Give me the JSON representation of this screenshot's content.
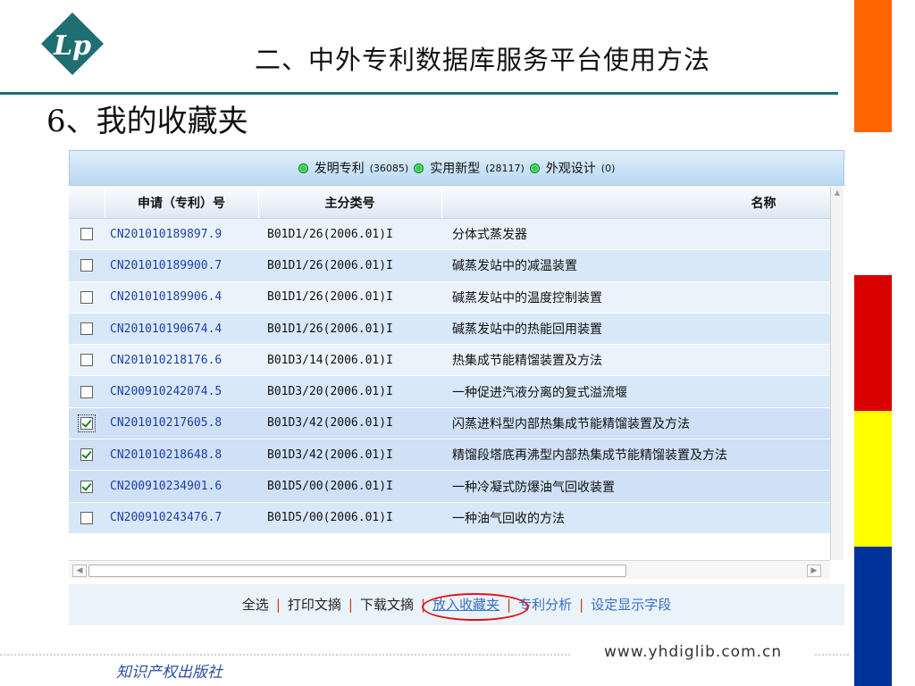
{
  "slide": {
    "title": "二、中外专利数据库服务平台使用方法",
    "subtitle": "6、我的收藏夹",
    "url": "www.yhdiglib.com.cn",
    "publisher": "知识产权出版社"
  },
  "colors": {
    "accent": "#1f6e72",
    "bar_orange": "#ff6600",
    "bar_red": "#d90000",
    "bar_yellow": "#ffff00",
    "bar_blue": "#003399",
    "link": "#3570c8",
    "annotation": "#e0141a"
  },
  "filters": [
    {
      "label": "发明专利",
      "count": "(36085)"
    },
    {
      "label": "实用新型",
      "count": "(28117)"
    },
    {
      "label": "外观设计",
      "count": "(0)"
    }
  ],
  "table": {
    "headers": [
      "申请（专利）号",
      "主分类号",
      "名称"
    ],
    "rows": [
      {
        "number": "CN201010189897.9",
        "class": "B01D1/26(2006.01)I",
        "name": "分体式蒸发器",
        "checked": false
      },
      {
        "number": "CN201010189900.7",
        "class": "B01D1/26(2006.01)I",
        "name": "碱蒸发站中的减温装置",
        "checked": false
      },
      {
        "number": "CN201010189906.4",
        "class": "B01D1/26(2006.01)I",
        "name": "碱蒸发站中的温度控制装置",
        "checked": false
      },
      {
        "number": "CN201010190674.4",
        "class": "B01D1/26(2006.01)I",
        "name": "碱蒸发站中的热能回用装置",
        "checked": false
      },
      {
        "number": "CN201010218176.6",
        "class": "B01D3/14(2006.01)I",
        "name": "热集成节能精馏装置及方法",
        "checked": false
      },
      {
        "number": "CN200910242074.5",
        "class": "B01D3/20(2006.01)I",
        "name": "一种促进汽液分离的复式溢流堰",
        "checked": false
      },
      {
        "number": "CN201010217605.8",
        "class": "B01D3/42(2006.01)I",
        "name": "闪蒸进料型内部热集成节能精馏装置及方法",
        "checked": true
      },
      {
        "number": "CN201010218648.8",
        "class": "B01D3/42(2006.01)I",
        "name": "精馏段塔底再沸型内部热集成节能精馏装置及方法",
        "checked": true
      },
      {
        "number": "CN200910234901.6",
        "class": "B01D5/00(2006.01)I",
        "name": "一种冷凝式防爆油气回收装置",
        "checked": true
      },
      {
        "number": "CN200910243476.7",
        "class": "B01D5/00(2006.01)I",
        "name": "一种油气回收的方法",
        "checked": false
      }
    ]
  },
  "actions": {
    "select_all": "全选",
    "print": "打印文摘",
    "download": "下载文摘",
    "add_favorite": "放入收藏夹",
    "analysis": "专利分析",
    "display_fields": "设定显示字段"
  }
}
